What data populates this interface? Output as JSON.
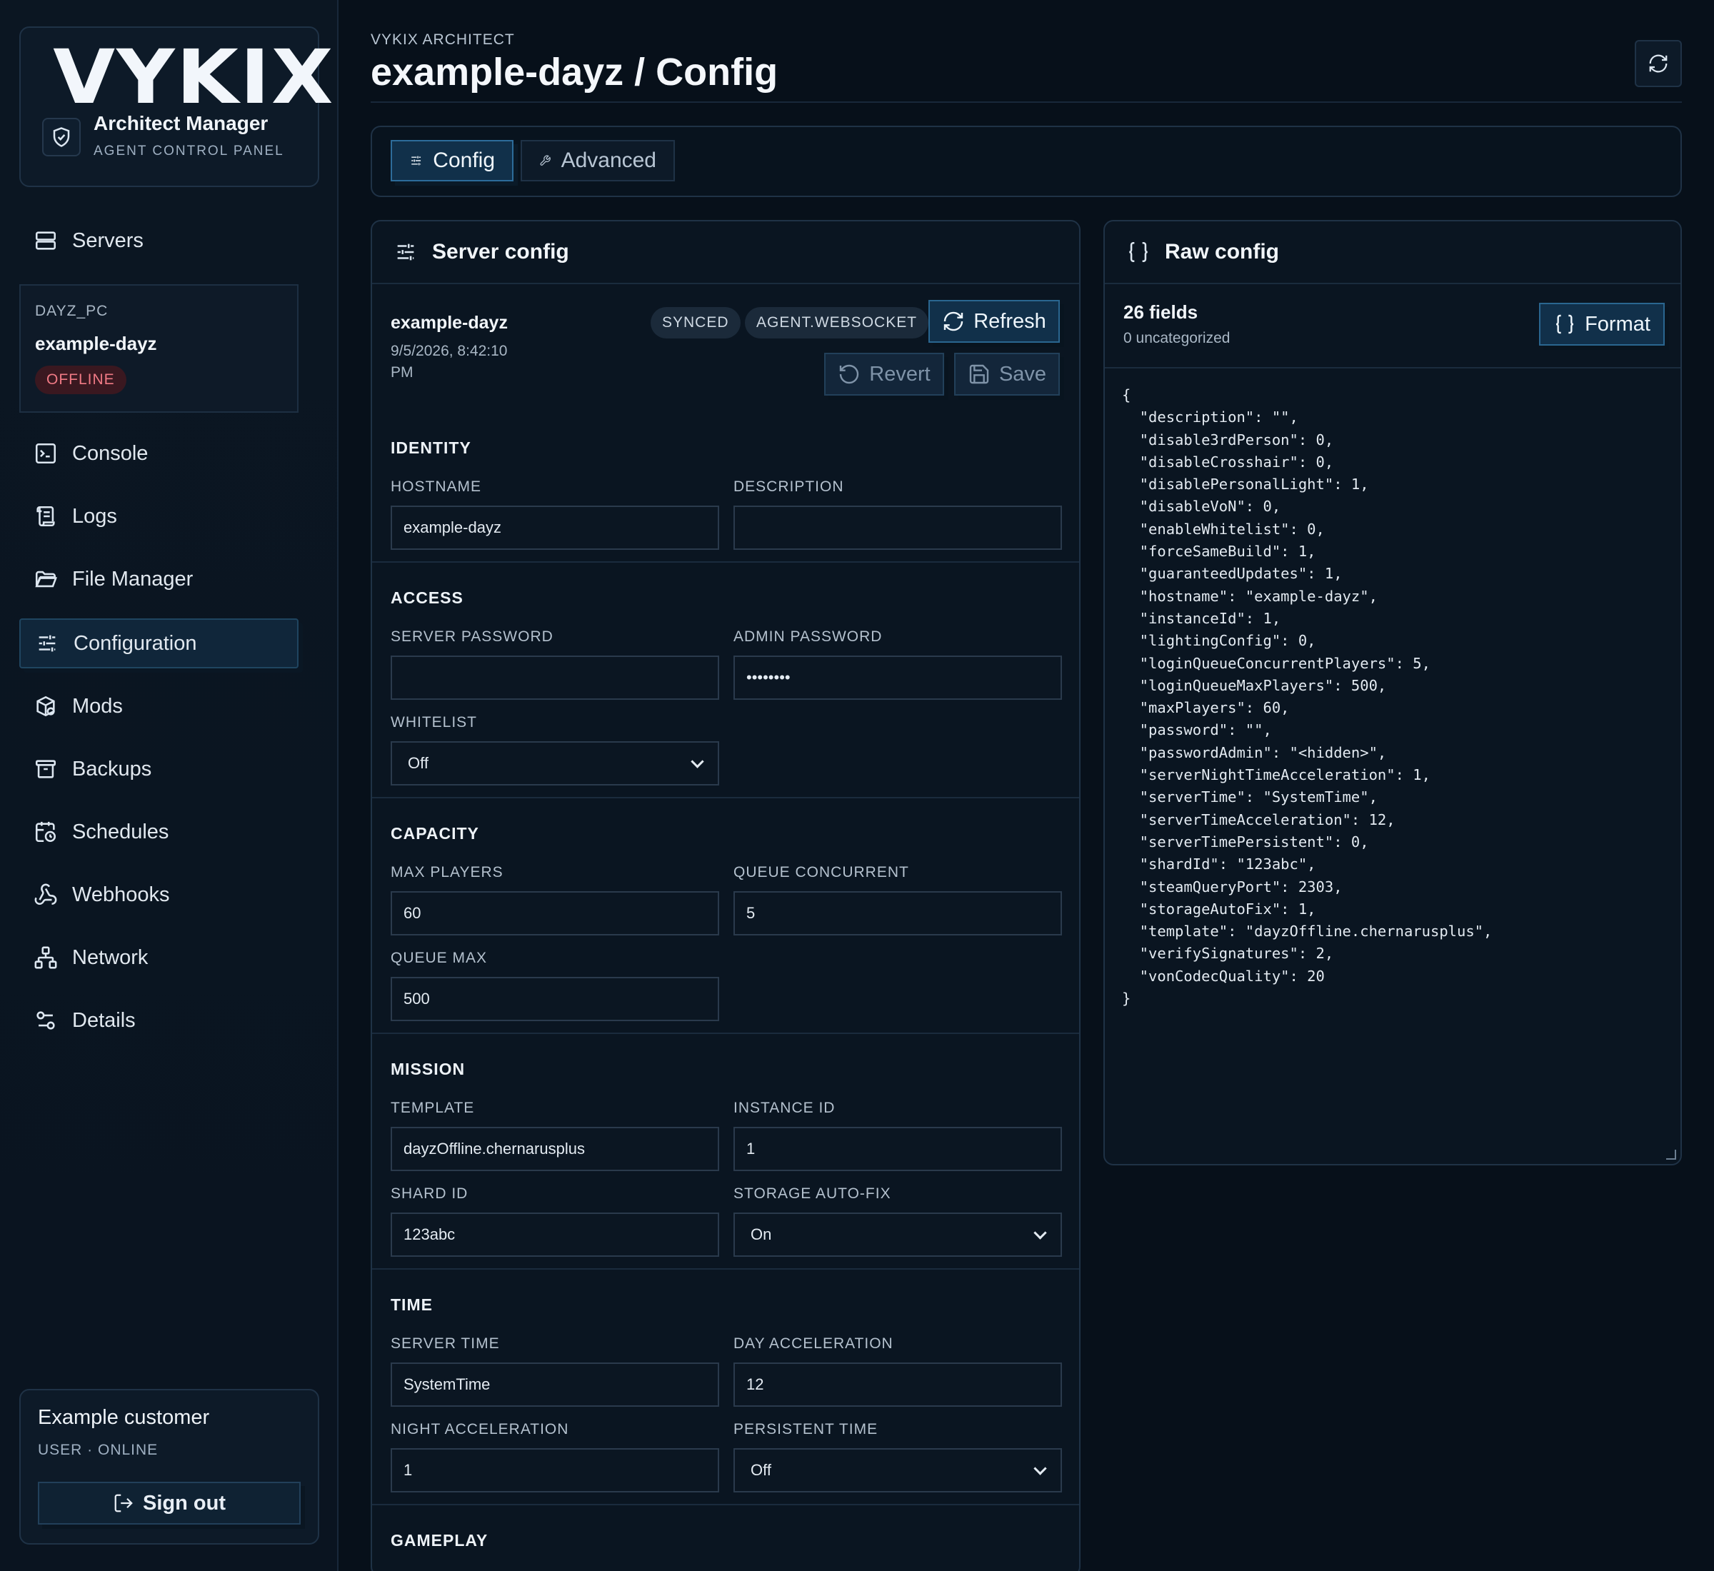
{
  "brand": {
    "logo": "VYKIX",
    "title": "Architect Manager",
    "subtitle": "AGENT CONTROL PANEL"
  },
  "sidebar": {
    "items": [
      {
        "label": "Servers",
        "icon": "servers-icon"
      },
      {
        "label": "Console",
        "icon": "terminal-icon"
      },
      {
        "label": "Logs",
        "icon": "scroll-icon"
      },
      {
        "label": "File Manager",
        "icon": "folder-icon"
      },
      {
        "label": "Configuration",
        "icon": "sliders-icon",
        "active": true
      },
      {
        "label": "Mods",
        "icon": "package-icon"
      },
      {
        "label": "Backups",
        "icon": "archive-icon"
      },
      {
        "label": "Schedules",
        "icon": "calendar-clock-icon"
      },
      {
        "label": "Webhooks",
        "icon": "webhook-icon"
      },
      {
        "label": "Network",
        "icon": "network-icon"
      },
      {
        "label": "Details",
        "icon": "settings-details-icon"
      }
    ],
    "server": {
      "tag": "DAYZ_PC",
      "name": "example-dayz",
      "status": "OFFLINE",
      "status_color": "#f07a85"
    },
    "user": {
      "name": "Example customer",
      "status": "USER · ONLINE",
      "sign_out": "Sign out"
    }
  },
  "header": {
    "breadcrumb": "VYKIX ARCHITECT",
    "title": "example-dayz / Config"
  },
  "tabs": [
    {
      "label": "Config",
      "active": true
    },
    {
      "label": "Advanced"
    }
  ],
  "server_config": {
    "title": "Server config",
    "name": "example-dayz",
    "timestamp": "9/5/2026, 8:42:10 PM",
    "badges": [
      "SYNCED",
      "AGENT.WEBSOCKET"
    ],
    "refresh": "Refresh",
    "revert": "Revert",
    "save": "Save",
    "identity": {
      "title": "IDENTITY",
      "hostname_label": "HOSTNAME",
      "hostname": "example-dayz",
      "description_label": "DESCRIPTION",
      "description": ""
    },
    "access": {
      "title": "ACCESS",
      "server_password_label": "SERVER PASSWORD",
      "server_password": "",
      "admin_password_label": "ADMIN PASSWORD",
      "admin_password": "••••••••",
      "whitelist_label": "WHITELIST",
      "whitelist": "Off"
    },
    "capacity": {
      "title": "CAPACITY",
      "max_players_label": "MAX PLAYERS",
      "max_players": "60",
      "queue_concurrent_label": "QUEUE CONCURRENT",
      "queue_concurrent": "5",
      "queue_max_label": "QUEUE MAX",
      "queue_max": "500"
    },
    "mission": {
      "title": "MISSION",
      "template_label": "TEMPLATE",
      "template": "dayzOffline.chernarusplus",
      "instance_id_label": "INSTANCE ID",
      "instance_id": "1",
      "shard_id_label": "SHARD ID",
      "shard_id": "123abc",
      "storage_autofix_label": "STORAGE AUTO-FIX",
      "storage_autofix": "On"
    },
    "time": {
      "title": "TIME",
      "server_time_label": "SERVER TIME",
      "server_time": "SystemTime",
      "day_accel_label": "DAY ACCELERATION",
      "day_accel": "12",
      "night_accel_label": "NIGHT ACCELERATION",
      "night_accel": "1",
      "persistent_label": "PERSISTENT TIME",
      "persistent": "Off"
    },
    "gameplay": {
      "title": "GAMEPLAY"
    }
  },
  "raw_config": {
    "title": "Raw config",
    "fields_count": "26 fields",
    "uncategorized": "0 uncategorized",
    "format": "Format",
    "json_text": "{\n  \"description\": \"\",\n  \"disable3rdPerson\": 0,\n  \"disableCrosshair\": 0,\n  \"disablePersonalLight\": 1,\n  \"disableVoN\": 0,\n  \"enableWhitelist\": 0,\n  \"forceSameBuild\": 1,\n  \"guaranteedUpdates\": 1,\n  \"hostname\": \"example-dayz\",\n  \"instanceId\": 1,\n  \"lightingConfig\": 0,\n  \"loginQueueConcurrentPlayers\": 5,\n  \"loginQueueMaxPlayers\": 500,\n  \"maxPlayers\": 60,\n  \"password\": \"\",\n  \"passwordAdmin\": \"<hidden>\",\n  \"serverNightTimeAcceleration\": 1,\n  \"serverTime\": \"SystemTime\",\n  \"serverTimeAcceleration\": 12,\n  \"serverTimePersistent\": 0,\n  \"shardId\": \"123abc\",\n  \"steamQueryPort\": 2303,\n  \"storageAutoFix\": 1,\n  \"template\": \"dayzOffline.chernarusplus\",\n  \"verifySignatures\": 2,\n  \"vonCodecQuality\": 20\n}"
  },
  "colors": {
    "background": "#07101a",
    "accent": "#4ab3e8",
    "panel_border": "#1f3246",
    "offline_badge": "#f07a85"
  }
}
